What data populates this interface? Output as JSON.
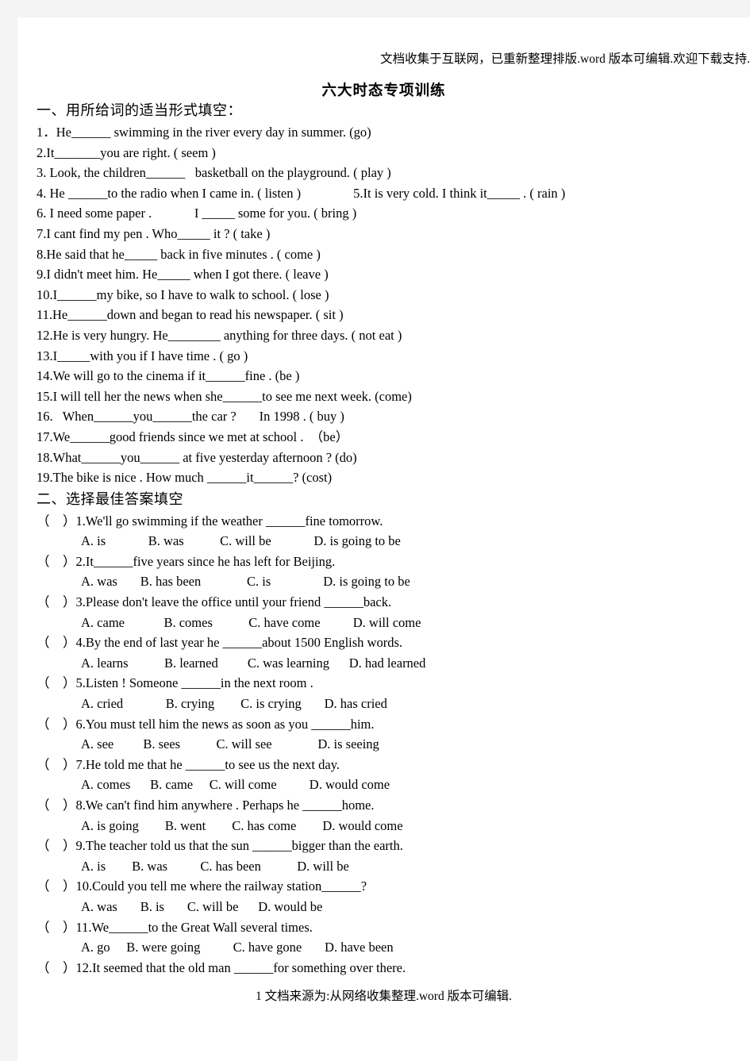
{
  "page": {
    "header_watermark": "文档收集于互联网，已重新整理排版.word 版本可编辑.欢迎下载支持.",
    "title": "六大时态专项训练",
    "footer_watermark": "1 文档来源为:从网络收集整理.word 版本可编辑.",
    "page_number": "1"
  },
  "section_one": {
    "heading": "一、用所给词的适当形式填空：",
    "items": [
      "1．He______ swimming in the river every day in summer. (go)",
      "2.It_______you are right. ( seem )",
      "3. Look, the children______   basketball on the playground. ( play )",
      "4. He ______to the radio when I came in. ( listen )                5.It is very cold. I think it_____ . ( rain )",
      "6. I need some paper .             I _____ some for you. ( bring )",
      "7.I cant find my pen . Who_____ it ? ( take )",
      "8.He said that he_____ back in five minutes . ( come )",
      "9.I didn't meet him. He_____ when I got there. ( leave )",
      "10.I______my bike, so I have to walk to school. ( lose )",
      "11.He______down and began to read his newspaper. ( sit )",
      "12.He is very hungry. He________ anything for three days. ( not eat )",
      "13.I_____with you if I have time . ( go )",
      "14.We will go to the cinema if it______fine . (be )",
      "15.I will tell her the news when she______to see me next week. (come)",
      "16.   When______you______the car ?       In 1998 . ( buy )",
      "17.We______good friends since we met at school .  （be）",
      "18.What______you______ at five yesterday afternoon ? (do)",
      "19.The bike is nice . How much ______it______? (cost)"
    ]
  },
  "section_two": {
    "heading": "二、选择最佳答案填空",
    "questions": [
      {
        "stem": "（    ）1.We'll go swimming if the weather ______fine tomorrow.",
        "options": "A. is             B. was           C. will be             D. is going to be"
      },
      {
        "stem": "（    ）2.It______five years since he has left for Beijing.",
        "options": "A. was       B. has been              C. is                D. is going to be"
      },
      {
        "stem": "（    ）3.Please don't leave the office until your friend ______back.",
        "options": "A. came            B. comes           C. have come          D. will come"
      },
      {
        "stem": "（    ）4.By the end of last year he ______about 1500 English words.",
        "options": "A. learns           B. learned         C. was learning      D. had learned"
      },
      {
        "stem": "（    ）5.Listen ! Someone ______in the next room .",
        "options": "A. cried             B. crying        C. is crying       D. has cried"
      },
      {
        "stem": "（    ）6.You must tell him the news as soon as you ______him.",
        "options": "A. see         B. sees           C. will see              D. is seeing"
      },
      {
        "stem": "（    ）7.He told me that he ______to see us the next day.",
        "options": "A. comes      B. came     C. will come          D. would come"
      },
      {
        "stem": "（    ）8.We can't find him anywhere . Perhaps he ______home.",
        "options": "A. is going        B. went        C. has come        D. would come"
      },
      {
        "stem": "（    ）9.The teacher told us that the sun ______bigger than the earth.",
        "options": "A. is        B. was          C. has been           D. will be"
      },
      {
        "stem": "（    ）10.Could you tell me where the railway station______?",
        "options": "A. was       B. is       C. will be      D. would be"
      },
      {
        "stem": "（    ）11.We______to the Great Wall several times.",
        "options": "A. go     B. were going          C. have gone       D. have been"
      },
      {
        "stem": "（    ）12.It seemed that the old man ______for something over there.",
        "options": ""
      }
    ]
  }
}
